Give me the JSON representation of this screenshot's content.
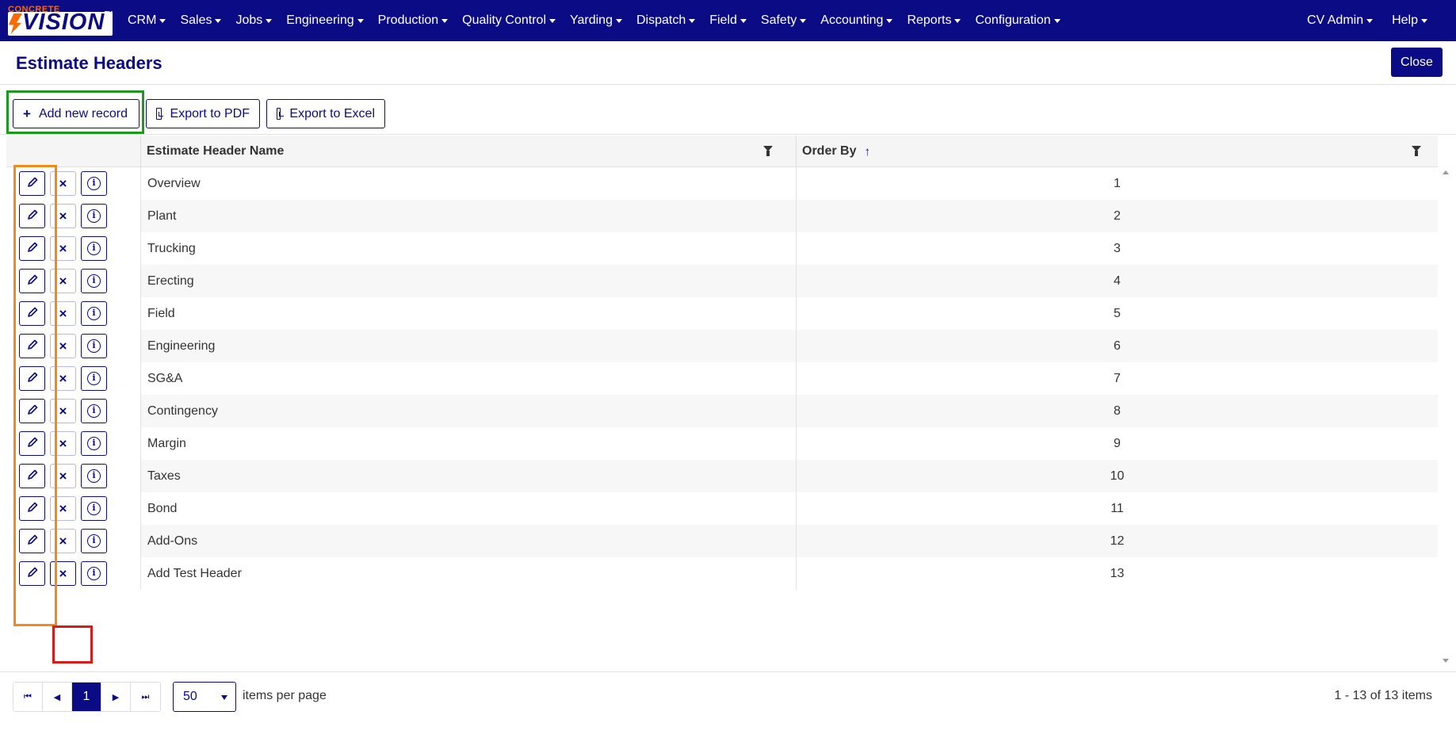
{
  "navbar": {
    "logo_small": "CONCRETE",
    "logo_big": "VISION",
    "logo_tm": "TM",
    "menu": [
      "CRM",
      "Sales",
      "Jobs",
      "Engineering",
      "Production",
      "Quality Control",
      "Yarding",
      "Dispatch",
      "Field",
      "Safety",
      "Accounting",
      "Reports",
      "Configuration"
    ],
    "user": "CV Admin",
    "help": "Help"
  },
  "header": {
    "title": "Estimate Headers",
    "close_label": "Close"
  },
  "toolbar": {
    "add_label": "Add new record",
    "pdf_label": "Export to PDF",
    "excel_label": "Export to Excel"
  },
  "grid": {
    "columns": {
      "name": "Estimate Header Name",
      "order": "Order By",
      "sort_indicator": "↑"
    },
    "rows": [
      {
        "name": "Overview",
        "order": "1"
      },
      {
        "name": "Plant",
        "order": "2"
      },
      {
        "name": "Trucking",
        "order": "3"
      },
      {
        "name": "Erecting",
        "order": "4"
      },
      {
        "name": "Field",
        "order": "5"
      },
      {
        "name": "Engineering",
        "order": "6"
      },
      {
        "name": "SG&A",
        "order": "7"
      },
      {
        "name": "Contingency",
        "order": "8"
      },
      {
        "name": "Margin",
        "order": "9"
      },
      {
        "name": "Taxes",
        "order": "10"
      },
      {
        "name": "Bond",
        "order": "11"
      },
      {
        "name": "Add-Ons",
        "order": "12"
      },
      {
        "name": "Add Test Header",
        "order": "13"
      }
    ]
  },
  "pager": {
    "current_page": "1",
    "page_size": "50",
    "page_size_label": "items per page",
    "info": "1 - 13 of 13 items"
  },
  "colors": {
    "brand": "#0b0b85",
    "accent": "#ff6a00",
    "highlight_green": "#1d9a1d",
    "highlight_orange": "#f08a18",
    "highlight_red": "#d91a1a"
  }
}
